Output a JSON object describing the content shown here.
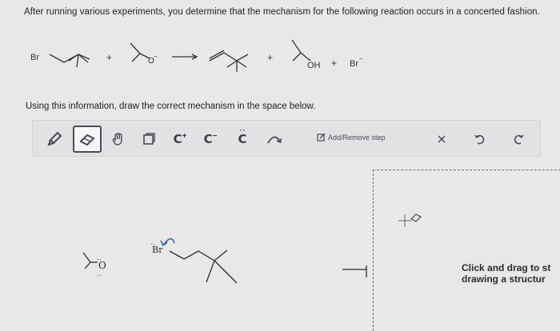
{
  "question": {
    "text": "After running various experiments, you determine that the mechanism for the following reaction occurs in a concerted fashion."
  },
  "reaction": {
    "br_label": "Br",
    "o_minus_label": "O",
    "charge_minus": "−",
    "plus_sign": "+",
    "oh_label": "OH",
    "br_minus_label": "Br"
  },
  "instruction": {
    "text": "Using this information, draw the correct mechanism in the space below."
  },
  "toolbar": {
    "carbocation_label": "C",
    "carbocation_sup": "+",
    "carbanion_label": "C",
    "carbanion_sup": "−",
    "carbene_label": "C",
    "add_remove_label": "Add/Remove step"
  },
  "workspace": {
    "br_atom": "Br",
    "o_atom": "O",
    "hint_line1": "Click and drag to st",
    "hint_line2": "drawing a structur"
  },
  "colors": {
    "background": "#e9e8e6",
    "toolbar_bg": "#e2e2e4",
    "arrow_blue": "#2a5db0",
    "icon_dark": "#4a4a55"
  }
}
